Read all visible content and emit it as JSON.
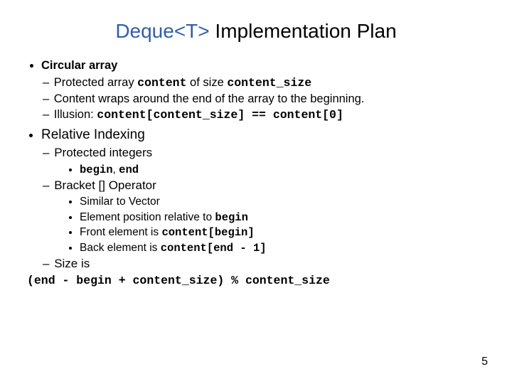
{
  "title": {
    "code_part": "Deque<T>",
    "rest": " Implementation Plan"
  },
  "circular": {
    "heading": "Circular array",
    "items": {
      "a_pre": "Protected array ",
      "a_code1": "content",
      "a_mid": " of size ",
      "a_code2": "content_size",
      "b": "Content wraps around the end of the array to the beginning.",
      "c_pre": "Illusion: ",
      "c_code": "content[content_size] == content[0]"
    }
  },
  "relative": {
    "heading": "Relative Indexing",
    "protected_label": "Protected integers",
    "protected_vars": {
      "v1": "begin",
      "comma": ", ",
      "v2": "end"
    },
    "bracket_label": "Bracket [] Operator",
    "bracket_items": {
      "a": "Similar to Vector",
      "b_pre": "Element position relative to ",
      "b_code": "begin",
      "c_pre": "Front element is ",
      "c_code": "content[begin]",
      "d_pre": "Back element is ",
      "d_code": "content[end - 1]"
    },
    "size_label": "Size is",
    "size_formula": "(end - begin + content_size) % content_size"
  },
  "page_number": "5"
}
